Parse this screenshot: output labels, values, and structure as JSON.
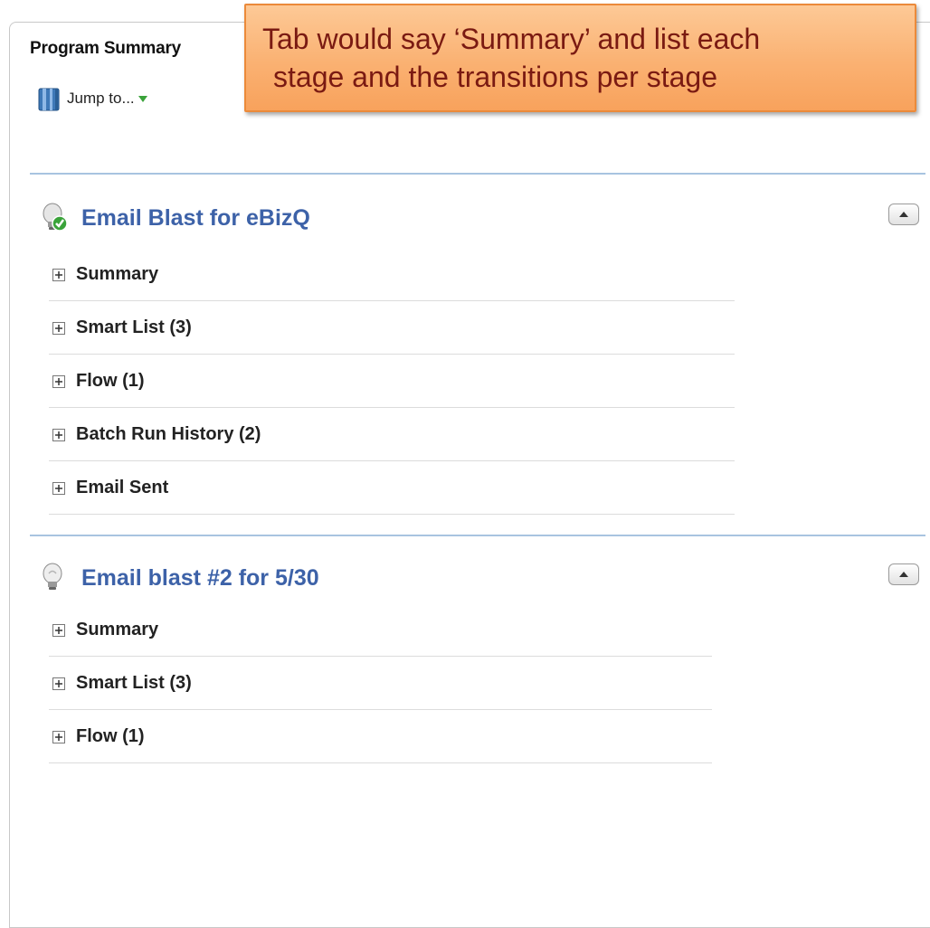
{
  "tab": {
    "title": "Program Summary"
  },
  "jump": {
    "label": "Jump to..."
  },
  "callout": {
    "line1": "Tab would say ‘Summary’ and list each",
    "line2": "stage and the transitions per stage"
  },
  "programs": [
    {
      "name": "Email Blast for eBizQ",
      "status_icon": "lightbulb-check-icon",
      "items": [
        {
          "label": "Summary"
        },
        {
          "label": "Smart List (3)"
        },
        {
          "label": "Flow (1)"
        },
        {
          "label": "Batch Run History (2)"
        },
        {
          "label": "Email Sent"
        }
      ]
    },
    {
      "name": "Email blast #2 for 5/30",
      "status_icon": "lightbulb-icon",
      "items": [
        {
          "label": "Summary"
        },
        {
          "label": "Smart List (3)"
        },
        {
          "label": "Flow (1)"
        }
      ]
    }
  ],
  "colors": {
    "title_blue": "#3d62a8",
    "divider_blue": "#a8c4e0",
    "callout_orange": "#fab172",
    "callout_text": "#7a1a12"
  }
}
